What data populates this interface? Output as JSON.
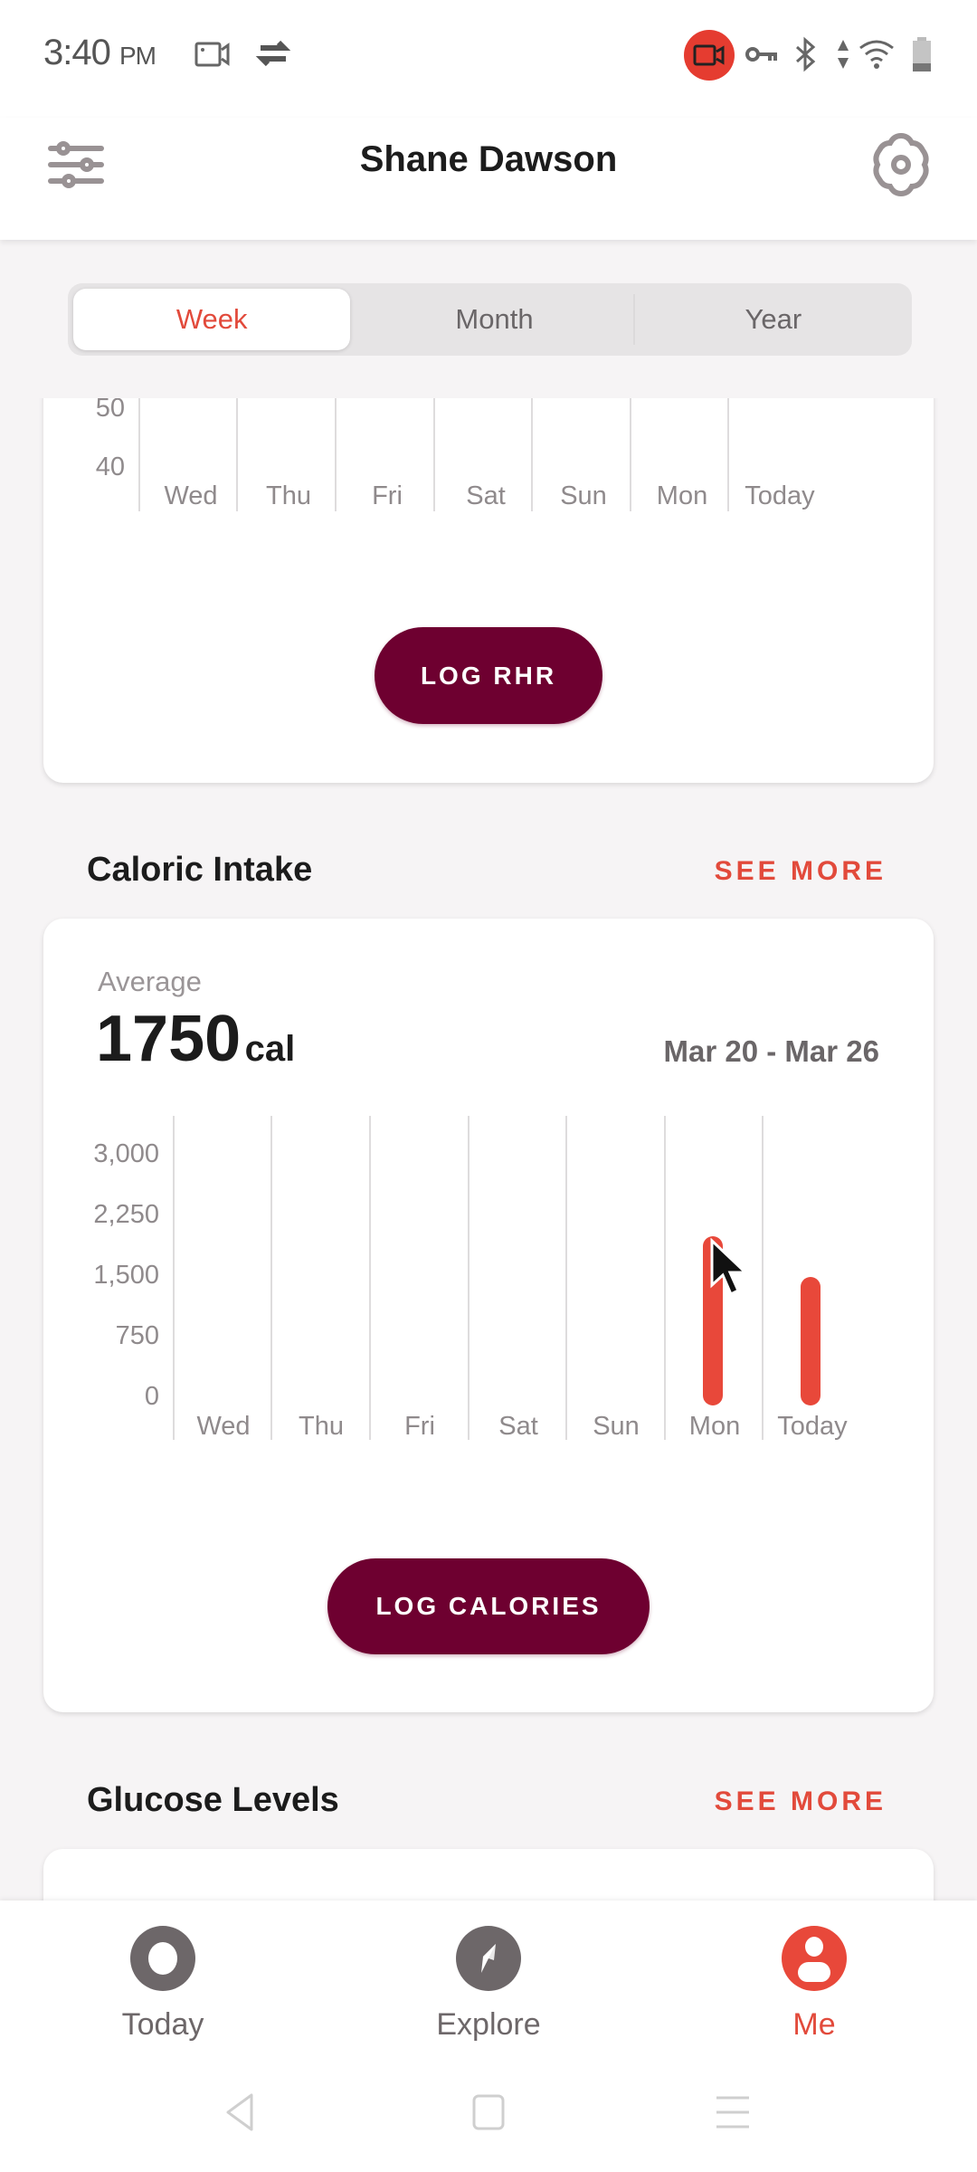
{
  "status_bar": {
    "time": "3:40",
    "ampm": "PM",
    "icons": [
      "screen-record-icon",
      "sync-icon",
      "recording-badge-icon",
      "vpn-key-icon",
      "bluetooth-icon",
      "data-arrows-icon",
      "wifi-icon",
      "battery-icon"
    ]
  },
  "header": {
    "title": "Shane Dawson",
    "left_icon": "filter-sliders-icon",
    "right_icon": "settings-gear-icon"
  },
  "period_tabs": {
    "items": [
      {
        "label": "Week",
        "active": true
      },
      {
        "label": "Month",
        "active": false
      },
      {
        "label": "Year",
        "active": false
      }
    ]
  },
  "rhr_section": {
    "y_tick_labels": [
      "50",
      "40"
    ],
    "days": [
      "Wed",
      "Thu",
      "Fri",
      "Sat",
      "Sun",
      "Mon",
      "Today"
    ],
    "button_label": "LOG RHR"
  },
  "caloric_section": {
    "title": "Caloric Intake",
    "see_more": "SEE MORE",
    "average_label": "Average",
    "average_value": "1750",
    "average_unit": "cal",
    "date_range": "Mar 20 - Mar 26",
    "button_label": "LOG CALORIES"
  },
  "glucose_section": {
    "title": "Glucose Levels",
    "see_more": "SEE MORE"
  },
  "bottom_nav": {
    "items": [
      {
        "label": "Today",
        "icon": "today-ring-icon",
        "active": false
      },
      {
        "label": "Explore",
        "icon": "compass-icon",
        "active": false
      },
      {
        "label": "Me",
        "icon": "profile-icon",
        "active": true
      }
    ]
  },
  "colors": {
    "accent": "#e24a3b",
    "button": "#6e0030",
    "bar": "#e8483a",
    "muted_text": "#8f8a8c",
    "background": "#f6f4f5"
  },
  "chart_data": {
    "type": "bar",
    "title": "Caloric Intake",
    "categories": [
      "Wed",
      "Thu",
      "Fri",
      "Sat",
      "Sun",
      "Mon",
      "Today"
    ],
    "values": [
      null,
      null,
      null,
      null,
      null,
      2000,
      1500
    ],
    "y_ticks": [
      0,
      750,
      1500,
      2250,
      3000
    ],
    "y_tick_labels": [
      "0",
      "750",
      "1,500",
      "2,250",
      "3,000"
    ],
    "ylim": [
      0,
      3000
    ],
    "xlabel": "",
    "ylabel": "",
    "grid": "vertical",
    "legend": "none"
  }
}
